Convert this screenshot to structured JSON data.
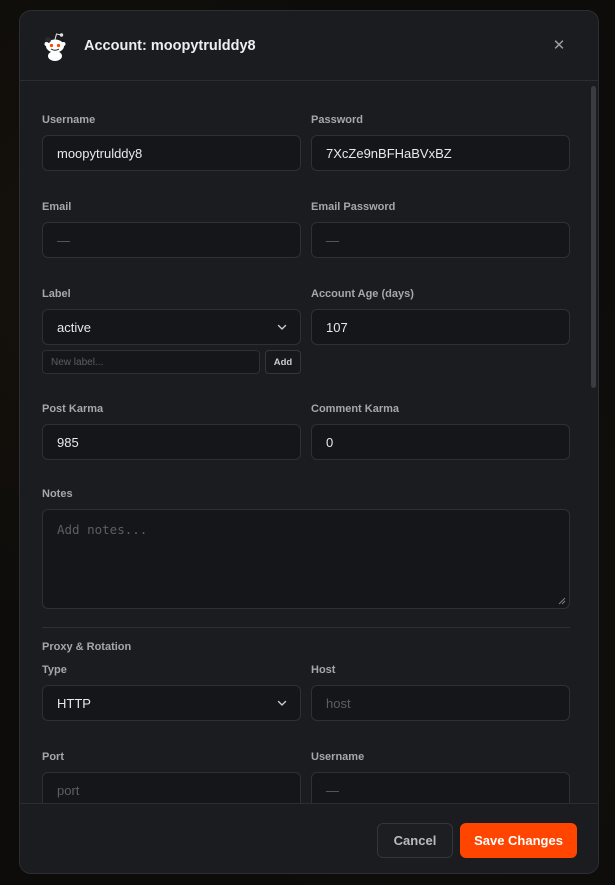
{
  "modal": {
    "title": "Account: moopytrulddy8",
    "close_symbol": "✕",
    "avatar_icon": "reddit-snoo-icon"
  },
  "form": {
    "username": {
      "label": "Username",
      "value": "moopytrulddy8"
    },
    "password": {
      "label": "Password",
      "value": "7XcZe9nBFHaBVxBZ"
    },
    "email": {
      "label": "Email",
      "placeholder": "—"
    },
    "email_password": {
      "label": "Email Password",
      "placeholder": "—"
    },
    "label": {
      "label": "Label",
      "selected": "active",
      "new_label_placeholder": "New label...",
      "add_button": "Add"
    },
    "account_age": {
      "label": "Account Age (days)",
      "value": "107"
    },
    "post_karma": {
      "label": "Post Karma",
      "value": "985"
    },
    "comment_karma": {
      "label": "Comment Karma",
      "value": "0"
    },
    "notes": {
      "label": "Notes",
      "placeholder": "Add notes..."
    }
  },
  "proxy": {
    "section_title": "Proxy & Rotation",
    "type": {
      "label": "Type",
      "selected": "HTTP"
    },
    "host": {
      "label": "Host",
      "placeholder": "host"
    },
    "port": {
      "label": "Port",
      "placeholder": "port"
    },
    "username": {
      "label": "Username",
      "placeholder": "—"
    }
  },
  "footer": {
    "cancel_label": "Cancel",
    "save_label": "Save Changes"
  },
  "colors": {
    "accent": "#ff4500",
    "panel": "#1b1c1f",
    "input_bg": "#151619"
  }
}
